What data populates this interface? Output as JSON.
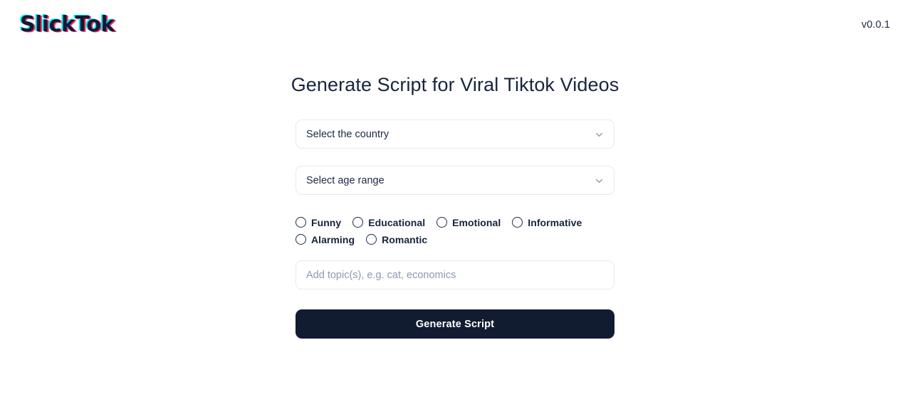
{
  "header": {
    "brand": "SlickTok",
    "version": "v0.0.1"
  },
  "main": {
    "title": "Generate Script for Viral Tiktok Videos",
    "country_select": {
      "value": "Select the country",
      "icon": "chevron-down-icon"
    },
    "age_select": {
      "value": "Select age range",
      "icon": "chevron-down-icon"
    },
    "tone_options": [
      {
        "label": "Funny",
        "checked": false
      },
      {
        "label": "Educational",
        "checked": false
      },
      {
        "label": "Emotional",
        "checked": false
      },
      {
        "label": "Informative",
        "checked": false
      },
      {
        "label": "Alarming",
        "checked": false
      },
      {
        "label": "Romantic",
        "checked": false
      }
    ],
    "topic_input": {
      "value": "",
      "placeholder": "Add topic(s), e.g. cat, economics"
    },
    "submit_label": "Generate Script"
  },
  "colors": {
    "brand_text": "#15173a",
    "brand_glitch_cyan": "#00f2ea",
    "brand_glitch_pink": "#ff2e63",
    "button_bg": "#111c30",
    "border": "#e4e8ef",
    "placeholder": "#8b9ab4",
    "text": "#18253d"
  }
}
